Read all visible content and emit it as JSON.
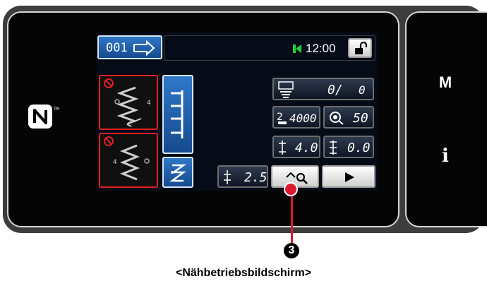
{
  "header": {
    "pattern_number": "001",
    "time": "12:00"
  },
  "counter": {
    "current": "0/",
    "target": "0"
  },
  "settings": {
    "max_speed": "4000",
    "tension": "50",
    "stitch_length_a": "4.0",
    "stitch_length_b": "0.0",
    "pitch": "2.5"
  },
  "side_panel": {
    "mode_key": "M",
    "info_key": "i"
  },
  "callout": {
    "number": "3"
  },
  "caption": "<Nähbetriebsbildschirm>",
  "colors": {
    "screen_background": "#060b18",
    "accent_blue": "#2f78c8",
    "alert_red": "#e02020",
    "callout_red": "#e0192c"
  }
}
